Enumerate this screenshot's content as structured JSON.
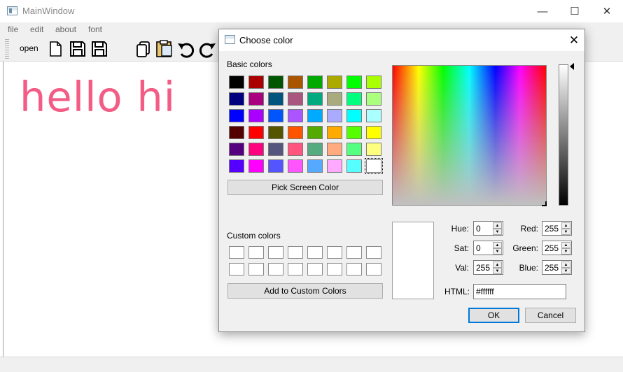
{
  "window": {
    "title": "MainWindow",
    "minimize_glyph": "—",
    "maximize_glyph": "☐",
    "close_glyph": "✕"
  },
  "menu": [
    "file",
    "edit",
    "about",
    "font"
  ],
  "toolbar": {
    "open_label": "open",
    "icons": [
      "new-file-icon",
      "save-icon",
      "save-as-icon",
      "copy-icon",
      "paste-icon",
      "undo-icon",
      "redo-icon"
    ]
  },
  "editor": {
    "text": "hello hi",
    "text_color": "#f25c85"
  },
  "dialog": {
    "title": "Choose color",
    "close_glyph": "✕",
    "basic_colors_label": "Basic colors",
    "basic_colors": [
      [
        "#000000",
        "#aa0000",
        "#005500",
        "#aa5500",
        "#00aa00",
        "#aaaa00",
        "#00ff00",
        "#aaff00"
      ],
      [
        "#00007f",
        "#aa007f",
        "#00557f",
        "#aa557f",
        "#00aa7f",
        "#aaaa7f",
        "#00ff7f",
        "#aaff7f"
      ],
      [
        "#0000ff",
        "#aa00ff",
        "#0055ff",
        "#aa55ff",
        "#00aaff",
        "#aaaaff",
        "#00ffff",
        "#aaffff"
      ],
      [
        "#550000",
        "#ff0000",
        "#555500",
        "#ff5500",
        "#55aa00",
        "#ffaa00",
        "#55ff00",
        "#ffff00"
      ],
      [
        "#55007f",
        "#ff007f",
        "#55557f",
        "#ff557f",
        "#55aa7f",
        "#ffaa7f",
        "#55ff7f",
        "#ffff7f"
      ],
      [
        "#5500ff",
        "#ff00ff",
        "#5555ff",
        "#ff55ff",
        "#55aaff",
        "#ffaaff",
        "#55ffff",
        "#ffffff"
      ]
    ],
    "selected_basic_color": "#ffffff",
    "pick_screen_label": "Pick Screen Color",
    "custom_colors_label": "Custom colors",
    "add_custom_label": "Add to Custom Colors",
    "fields": {
      "hue": {
        "label": "Hue:",
        "value": "0"
      },
      "sat": {
        "label": "Sat:",
        "value": "0"
      },
      "val": {
        "label": "Val:",
        "value": "255"
      },
      "red": {
        "label": "Red:",
        "value": "255"
      },
      "green": {
        "label": "Green:",
        "value": "255"
      },
      "blue": {
        "label": "Blue:",
        "value": "255"
      }
    },
    "html_label": "HTML:",
    "html_value": "#ffffff",
    "ok_label": "OK",
    "cancel_label": "Cancel"
  }
}
